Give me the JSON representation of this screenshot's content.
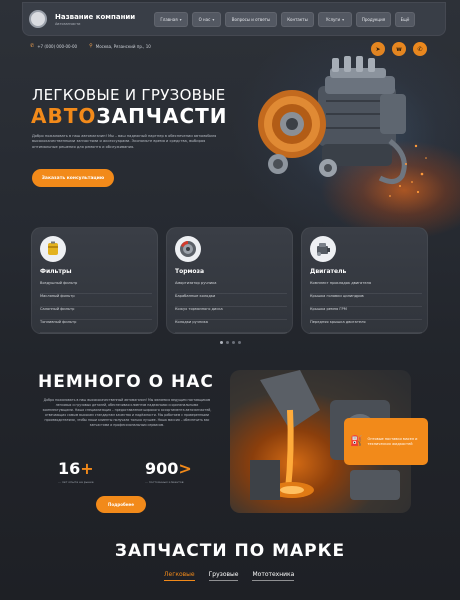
{
  "header": {
    "company_name": "Название компании",
    "company_sub": "Автозапчасти",
    "nav": [
      {
        "label": "Главная",
        "dropdown": true
      },
      {
        "label": "О нас",
        "dropdown": true
      },
      {
        "label": "Вопросы и ответы",
        "dropdown": false
      },
      {
        "label": "Контакты",
        "dropdown": false
      },
      {
        "label": "Услуги",
        "dropdown": true
      },
      {
        "label": "Продукция",
        "dropdown": false
      },
      {
        "label": "Ещё",
        "dropdown": false
      }
    ],
    "phone": "+7 (000) 000-00-00",
    "address": "Москва, Рязанский пр., 10"
  },
  "hero": {
    "title_line1": "ЛЕГКОВЫЕ И ГРУЗОВЫЕ",
    "title_accent": "АВТО",
    "title_rest": "ЗАПЧАСТИ",
    "text": "Добро пожаловать в наш автомагазин! Мы – ваш надежный партнер в обеспечении автомобиля высококачественными запчастями и аксессуарами. Экономьте время и средства, выбирая оптимальные решения для ремонта и обслуживания.",
    "cta": "Заказать консультацию"
  },
  "cards": [
    {
      "title": "Фильтры",
      "icon": "oil-filter-icon",
      "items": [
        "Воздушный фильтр",
        "Масляный фильтр",
        "Салонный фильтр",
        "Топливный фильтр"
      ]
    },
    {
      "title": "Тормоза",
      "icon": "brake-disc-icon",
      "items": [
        "Амортизатор ручника",
        "Барабанные колодки",
        "Кожух тормозного диска",
        "Колодки ручника"
      ]
    },
    {
      "title": "Двигатель",
      "icon": "engine-icon",
      "items": [
        "Комплект прокладок двигателя",
        "Крышка головки цилиндров",
        "Крышка ремня ГРМ",
        "Передняя крышка двигателя"
      ]
    }
  ],
  "about": {
    "title": "НЕМНОГО О НАС",
    "text": "Добро пожаловать в наш высококачественный автомагазин! Мы являемся ведущим поставщиком легковых и грузовых деталей, обеспечивая клиентов надежными и оригинальными комплектующими. Наша специализация – предоставление широкого ассортимента автозапчастей, отвечающих самым высоким стандартам качества и надёжности. Мы работаем с проверенными производителями, чтобы наши клиенты получали только лучшее. Наша миссия – обеспечить вас запчастями и профессиональным сервисом.",
    "stats": [
      {
        "num": "16",
        "suffix": "+",
        "label": "... лет опыта на рынке"
      },
      {
        "num": "900",
        "suffix": ">",
        "label": "... постоянных клиентов"
      }
    ],
    "more": "Подробнее",
    "oil_card": "Оптовые поставки масел и технических жидкостей"
  },
  "brands": {
    "title": "ЗАПЧАСТИ ПО МАРКЕ",
    "tabs": [
      "Легковые",
      "Грузовые",
      "Мототехника"
    ],
    "active_tab": 0
  },
  "colors": {
    "accent": "#f28a1a",
    "background": "#262a31",
    "card": "#353940"
  }
}
